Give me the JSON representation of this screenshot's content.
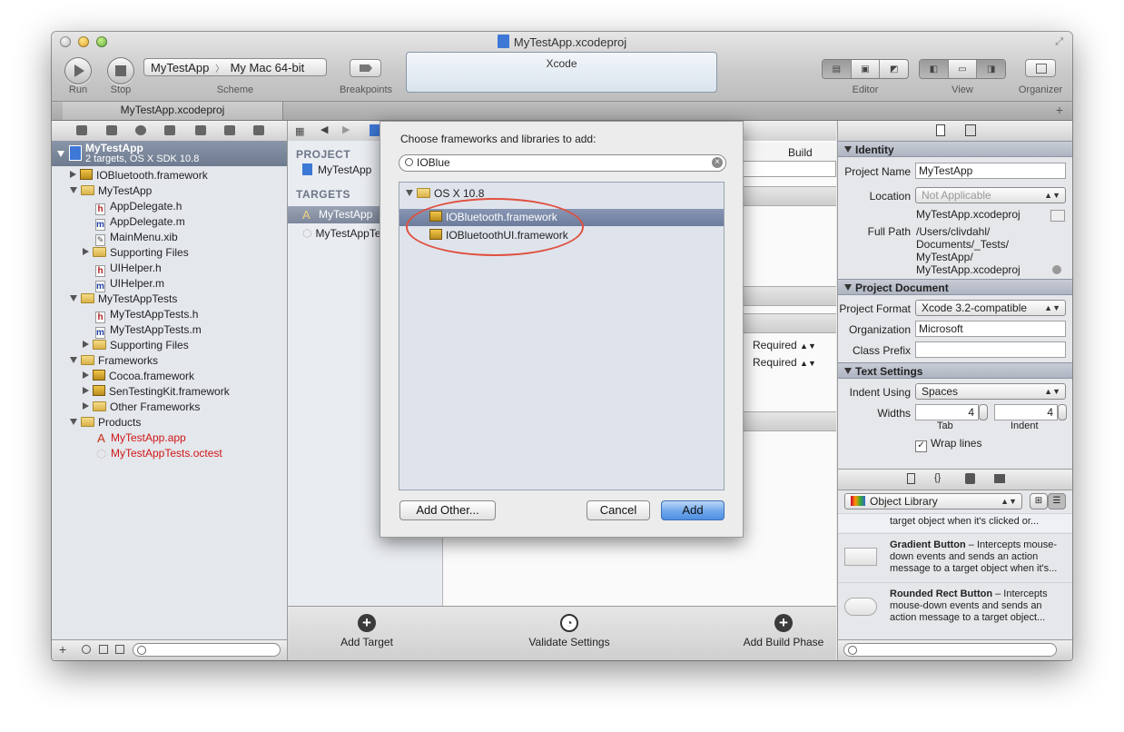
{
  "window": {
    "title": "MyTestApp.xcodeproj",
    "lcd_text": "Xcode"
  },
  "toolbar": {
    "run_label": "Run",
    "stop_label": "Stop",
    "scheme_label": "Scheme",
    "scheme_target": "MyTestApp",
    "scheme_separator": "〉",
    "scheme_destination": "My Mac 64-bit",
    "breakpoints_label": "Breakpoints",
    "editor_label": "Editor",
    "view_label": "View",
    "organizer_label": "Organizer"
  },
  "tabbar": {
    "tab_label": "MyTestApp.xcodeproj",
    "add_tab": "+"
  },
  "navigator": {
    "project_name": "MyTestApp",
    "project_subtitle": "2 targets, OS X SDK 10.8",
    "items": [
      {
        "label": "IOBluetooth.framework"
      },
      {
        "label": "MyTestApp"
      },
      {
        "label": "AppDelegate.h",
        "icon": "h"
      },
      {
        "label": "AppDelegate.m",
        "icon": "m"
      },
      {
        "label": "MainMenu.xib"
      },
      {
        "label": "Supporting Files"
      },
      {
        "label": "UIHelper.h",
        "icon": "h"
      },
      {
        "label": "UIHelper.m",
        "icon": "m"
      },
      {
        "label": "MyTestAppTests"
      },
      {
        "label": "MyTestAppTests.h",
        "icon": "h"
      },
      {
        "label": "MyTestAppTests.m",
        "icon": "m"
      },
      {
        "label": "Supporting Files"
      },
      {
        "label": "Frameworks"
      },
      {
        "label": "Cocoa.framework"
      },
      {
        "label": "SenTestingKit.framework"
      },
      {
        "label": "Other Frameworks"
      },
      {
        "label": "Products"
      },
      {
        "label": "MyTestApp.app"
      },
      {
        "label": "MyTestAppTests.octest"
      }
    ],
    "bottom_add": "+"
  },
  "editor": {
    "project_header": "PROJECT",
    "project_item": "MyTestApp",
    "targets_header": "TARGETS",
    "target_items": [
      "MyTestApp",
      "MyTestAppTests"
    ],
    "build_rules_tab": "Build Rule",
    "required_1": "Required",
    "required_2": "Required",
    "add_target": "Add Target",
    "validate_settings": "Validate Settings",
    "add_build_phase": "Add Build Phase"
  },
  "dialog": {
    "title": "Choose frameworks and libraries to add:",
    "search_value": "IOBlue",
    "group_label": "OS X 10.8",
    "results": [
      "IOBluetooth.framework",
      "IOBluetoothUI.framework"
    ],
    "add_other_label": "Add Other...",
    "cancel_label": "Cancel",
    "add_label": "Add",
    "highlight_color": "#e05040"
  },
  "inspector": {
    "identity_header": "Identity",
    "project_name_label": "Project Name",
    "project_name_value": "MyTestApp",
    "location_label": "Location",
    "location_value": "Not Applicable",
    "file_name": "MyTestApp.xcodeproj",
    "full_path_label": "Full Path",
    "full_path_lines": [
      "/Users/clivdahl/",
      "Documents/_Tests/",
      "MyTestApp/",
      "MyTestApp.xcodeproj"
    ],
    "project_document_header": "Project Document",
    "project_format_label": "Project Format",
    "project_format_value": "Xcode 3.2-compatible",
    "organization_label": "Organization",
    "organization_value": "Microsoft",
    "class_prefix_label": "Class Prefix",
    "class_prefix_value": "",
    "text_settings_header": "Text Settings",
    "indent_using_label": "Indent Using",
    "indent_using_value": "Spaces",
    "widths_label": "Widths",
    "tab_width": "4",
    "indent_width": "4",
    "tab_caption": "Tab",
    "indent_caption": "Indent",
    "wrap_lines_label": "Wrap lines",
    "library_selector": "Object Library",
    "library_items": [
      {
        "snippet": "target object when it's clicked or..."
      },
      {
        "title": "Gradient Button",
        "desc": " – Intercepts mouse-down events and sends an action message to a target object when it's..."
      },
      {
        "title": "Rounded Rect Button",
        "desc": " – Intercepts mouse-down events and sends an action message to a target object..."
      }
    ]
  },
  "colors": {
    "accent_blue": "#4f8fe2",
    "selection": "#6d7c9c",
    "product_red": "#d01818"
  }
}
